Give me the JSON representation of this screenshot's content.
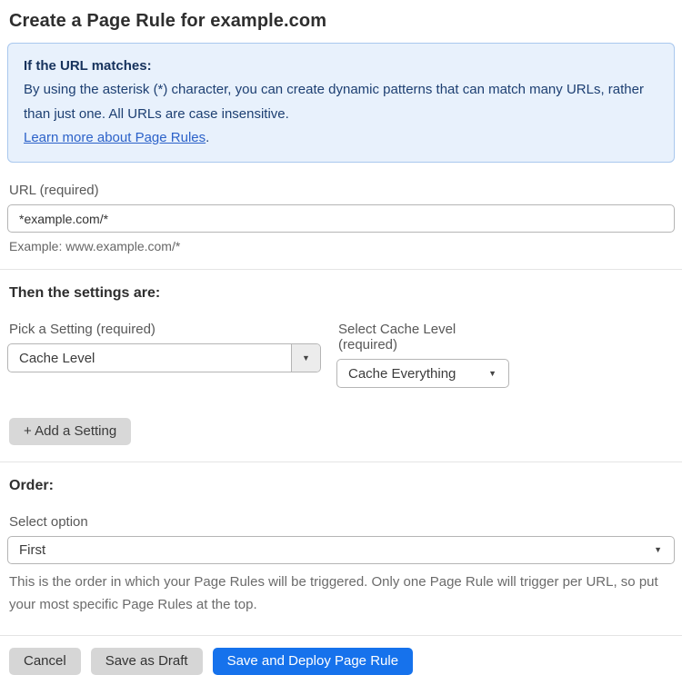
{
  "page": {
    "title": "Create a Page Rule for example.com"
  },
  "info_box": {
    "heading": "If the URL matches:",
    "body": "By using the asterisk (*) character, you can create dynamic patterns that can match many URLs, rather than just one. All URLs are case insensitive.",
    "link": "Learn more about Page Rules",
    "link_suffix": "."
  },
  "url_field": {
    "label": "URL (required)",
    "value": "*example.com/*",
    "hint": "Example: www.example.com/*"
  },
  "settings": {
    "heading": "Then the settings are:",
    "setting_select": {
      "label": "Pick a Setting (required)",
      "value": "Cache Level"
    },
    "cache_level_select": {
      "label": "Select Cache Level (required)",
      "value": "Cache Everything"
    },
    "add_setting_label": "+ Add a Setting"
  },
  "order": {
    "heading": "Order:",
    "select_label": "Select option",
    "value": "First",
    "help": "This is the order in which your Page Rules will be triggered. Only one Page Rule will trigger per URL, so put your most specific Page Rules at the top."
  },
  "actions": {
    "cancel": "Cancel",
    "save_draft": "Save as Draft",
    "save_deploy": "Save and Deploy Page Rule"
  },
  "colors": {
    "accent_blue": "#1672ec",
    "info_bg": "#e8f1fc",
    "info_border": "#a9c8ee",
    "info_text": "#1d3f72",
    "link_blue": "#2c62c9",
    "button_gray": "#d6d6d6"
  },
  "icons": {
    "dropdown_arrow": "▼"
  }
}
